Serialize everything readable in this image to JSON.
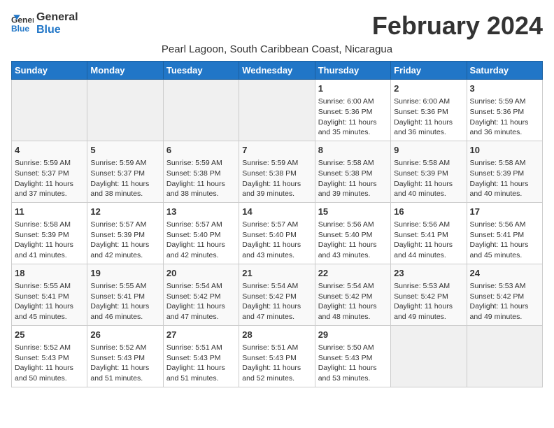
{
  "logo": {
    "line1": "General",
    "line2": "Blue"
  },
  "title": "February 2024",
  "subtitle": "Pearl Lagoon, South Caribbean Coast, Nicaragua",
  "days_header": [
    "Sunday",
    "Monday",
    "Tuesday",
    "Wednesday",
    "Thursday",
    "Friday",
    "Saturday"
  ],
  "weeks": [
    [
      {
        "day": "",
        "info": ""
      },
      {
        "day": "",
        "info": ""
      },
      {
        "day": "",
        "info": ""
      },
      {
        "day": "",
        "info": ""
      },
      {
        "day": "1",
        "info": "Sunrise: 6:00 AM\nSunset: 5:36 PM\nDaylight: 11 hours\nand 35 minutes."
      },
      {
        "day": "2",
        "info": "Sunrise: 6:00 AM\nSunset: 5:36 PM\nDaylight: 11 hours\nand 36 minutes."
      },
      {
        "day": "3",
        "info": "Sunrise: 5:59 AM\nSunset: 5:36 PM\nDaylight: 11 hours\nand 36 minutes."
      }
    ],
    [
      {
        "day": "4",
        "info": "Sunrise: 5:59 AM\nSunset: 5:37 PM\nDaylight: 11 hours\nand 37 minutes."
      },
      {
        "day": "5",
        "info": "Sunrise: 5:59 AM\nSunset: 5:37 PM\nDaylight: 11 hours\nand 38 minutes."
      },
      {
        "day": "6",
        "info": "Sunrise: 5:59 AM\nSunset: 5:38 PM\nDaylight: 11 hours\nand 38 minutes."
      },
      {
        "day": "7",
        "info": "Sunrise: 5:59 AM\nSunset: 5:38 PM\nDaylight: 11 hours\nand 39 minutes."
      },
      {
        "day": "8",
        "info": "Sunrise: 5:58 AM\nSunset: 5:38 PM\nDaylight: 11 hours\nand 39 minutes."
      },
      {
        "day": "9",
        "info": "Sunrise: 5:58 AM\nSunset: 5:39 PM\nDaylight: 11 hours\nand 40 minutes."
      },
      {
        "day": "10",
        "info": "Sunrise: 5:58 AM\nSunset: 5:39 PM\nDaylight: 11 hours\nand 40 minutes."
      }
    ],
    [
      {
        "day": "11",
        "info": "Sunrise: 5:58 AM\nSunset: 5:39 PM\nDaylight: 11 hours\nand 41 minutes."
      },
      {
        "day": "12",
        "info": "Sunrise: 5:57 AM\nSunset: 5:39 PM\nDaylight: 11 hours\nand 42 minutes."
      },
      {
        "day": "13",
        "info": "Sunrise: 5:57 AM\nSunset: 5:40 PM\nDaylight: 11 hours\nand 42 minutes."
      },
      {
        "day": "14",
        "info": "Sunrise: 5:57 AM\nSunset: 5:40 PM\nDaylight: 11 hours\nand 43 minutes."
      },
      {
        "day": "15",
        "info": "Sunrise: 5:56 AM\nSunset: 5:40 PM\nDaylight: 11 hours\nand 43 minutes."
      },
      {
        "day": "16",
        "info": "Sunrise: 5:56 AM\nSunset: 5:41 PM\nDaylight: 11 hours\nand 44 minutes."
      },
      {
        "day": "17",
        "info": "Sunrise: 5:56 AM\nSunset: 5:41 PM\nDaylight: 11 hours\nand 45 minutes."
      }
    ],
    [
      {
        "day": "18",
        "info": "Sunrise: 5:55 AM\nSunset: 5:41 PM\nDaylight: 11 hours\nand 45 minutes."
      },
      {
        "day": "19",
        "info": "Sunrise: 5:55 AM\nSunset: 5:41 PM\nDaylight: 11 hours\nand 46 minutes."
      },
      {
        "day": "20",
        "info": "Sunrise: 5:54 AM\nSunset: 5:42 PM\nDaylight: 11 hours\nand 47 minutes."
      },
      {
        "day": "21",
        "info": "Sunrise: 5:54 AM\nSunset: 5:42 PM\nDaylight: 11 hours\nand 47 minutes."
      },
      {
        "day": "22",
        "info": "Sunrise: 5:54 AM\nSunset: 5:42 PM\nDaylight: 11 hours\nand 48 minutes."
      },
      {
        "day": "23",
        "info": "Sunrise: 5:53 AM\nSunset: 5:42 PM\nDaylight: 11 hours\nand 49 minutes."
      },
      {
        "day": "24",
        "info": "Sunrise: 5:53 AM\nSunset: 5:42 PM\nDaylight: 11 hours\nand 49 minutes."
      }
    ],
    [
      {
        "day": "25",
        "info": "Sunrise: 5:52 AM\nSunset: 5:43 PM\nDaylight: 11 hours\nand 50 minutes."
      },
      {
        "day": "26",
        "info": "Sunrise: 5:52 AM\nSunset: 5:43 PM\nDaylight: 11 hours\nand 51 minutes."
      },
      {
        "day": "27",
        "info": "Sunrise: 5:51 AM\nSunset: 5:43 PM\nDaylight: 11 hours\nand 51 minutes."
      },
      {
        "day": "28",
        "info": "Sunrise: 5:51 AM\nSunset: 5:43 PM\nDaylight: 11 hours\nand 52 minutes."
      },
      {
        "day": "29",
        "info": "Sunrise: 5:50 AM\nSunset: 5:43 PM\nDaylight: 11 hours\nand 53 minutes."
      },
      {
        "day": "",
        "info": ""
      },
      {
        "day": "",
        "info": ""
      }
    ]
  ]
}
